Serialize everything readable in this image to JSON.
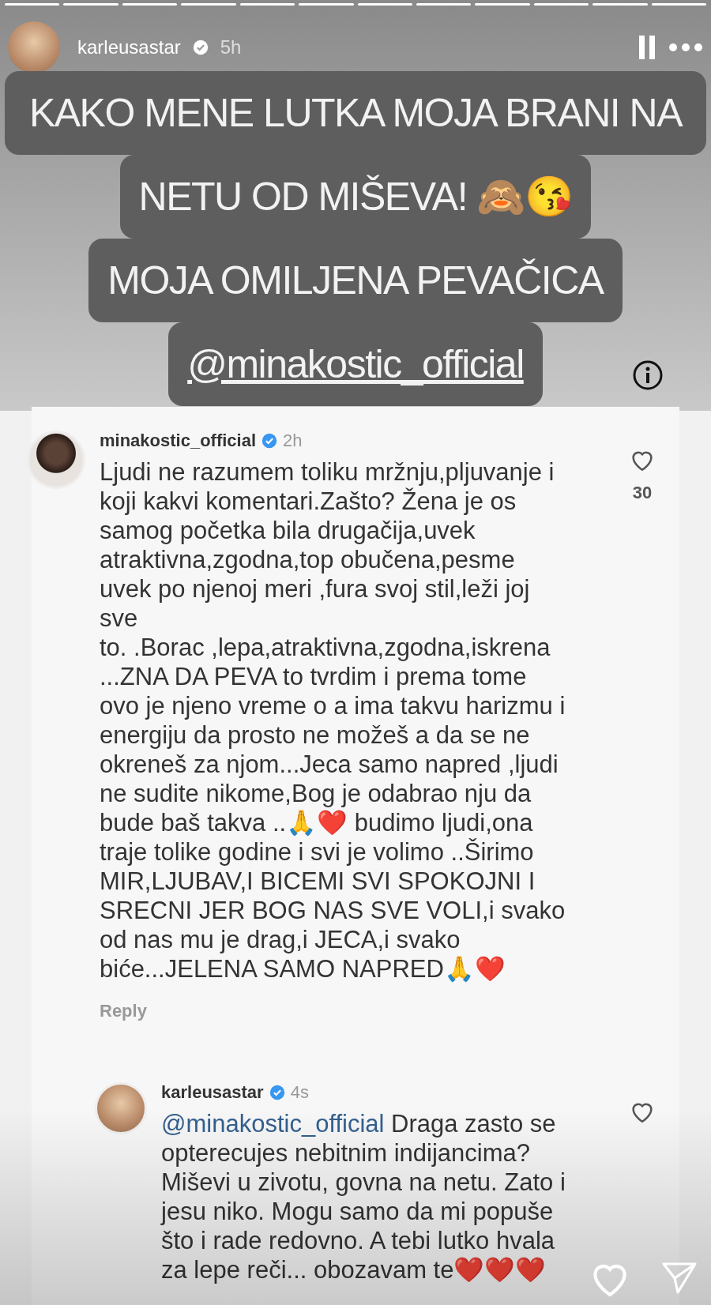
{
  "story": {
    "username": "karleusastar",
    "verified": true,
    "time": "5h"
  },
  "sticker": {
    "lines": [
      "KAKO MENE LUTKA MOJA BRANI NA",
      "NETU OD MIŠEVA! 🙈😘",
      "MOJA OMILJENA PEVAČICA"
    ],
    "mention": "@minakostic_official"
  },
  "comments": [
    {
      "username": "minakostic_official",
      "verified": true,
      "time": "2h",
      "liked": false,
      "likes": "30",
      "lines": [
        "Ljudi ne razumem toliku mržnju,pljuvanje i",
        "koji kakvi komentari.Zašto? Žena je os",
        "samog početka bila drugačija,uvek",
        "atraktivna,zgodna,top obučena,pesme",
        "uvek po njenoj meri ,fura svoj stil,leži joj",
        "sve",
        "to. .Borac ,lepa,atraktivna,zgodna,iskrena",
        "...ZNA DA PEVA to tvrdim i prema tome",
        "ovo je njeno vreme o a ima takvu harizmu i",
        "energiju da prosto ne možeš a da se ne",
        "okreneš za njom...Jeca samo napred ,ljudi",
        "ne sudite nikome,Bog je odabrao nju da",
        "bude baš takva ..🙏❤️ budimo ljudi,ona",
        "traje tolike godine i svi je volimo ..Širimo",
        "MIR,LJUBAV,I BICEMI SVI SPOKOJNI I",
        "SRECNI JER BOG NAS SVE VOLI,i svako",
        "od nas mu je drag,i JECA,i svako",
        "biće...JELENA SAMO NAPRED🙏❤️"
      ],
      "reply": "Reply"
    },
    {
      "username": "karleusastar",
      "verified": true,
      "time": "4s",
      "liked": false,
      "mention": "@minakostic_official",
      "lines": [
        " Draga zasto se",
        "opterecujes nebitnim indijancima?",
        "Miševi u zivotu, govna na netu. Zato i",
        "jesu niko. Mogu samo da mi popuše",
        "što i rade redovno. A tebi lutko hvala",
        "za lepe reči... obozavam te❤️❤️❤️"
      ]
    }
  ]
}
